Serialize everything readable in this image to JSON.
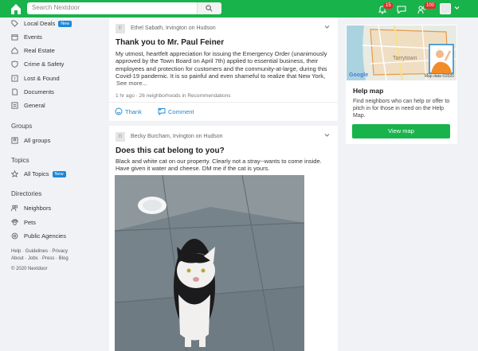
{
  "search": {
    "placeholder": "Search Nextdoor"
  },
  "top": {
    "notifications_count": "15",
    "inbox_count": "",
    "neighbors_count": "100"
  },
  "sidebar": {
    "items": [
      {
        "label": "Local Deals",
        "new": "New"
      },
      {
        "label": "Events"
      },
      {
        "label": "Real Estate"
      },
      {
        "label": "Crime & Safety"
      },
      {
        "label": "Lost & Found"
      },
      {
        "label": "Documents"
      },
      {
        "label": "General"
      }
    ],
    "groups_heading": "Groups",
    "groups": [
      {
        "label": "All groups"
      }
    ],
    "topics_heading": "Topics",
    "topics": [
      {
        "label": "All Topics",
        "new": "New"
      }
    ],
    "directories_heading": "Directories",
    "directories": [
      {
        "label": "Neighbors"
      },
      {
        "label": "Pets"
      },
      {
        "label": "Public Agencies"
      }
    ],
    "footer": {
      "line1": "Help · Guidelines · Privacy",
      "line2": "About · Jobs · Press · Blog",
      "copyright": "© 2020 Nextdoor"
    }
  },
  "posts": [
    {
      "avatar_letter": "E",
      "author": "Ethel Sabath, Irvington on Hudson",
      "title": "Thank you to Mr. Paul Feiner",
      "body_lines": [
        "My utmost, heartfelt appreciation for issuing the Emergency Order (unanimously",
        "approved by the Town Board on April 7th) applied to essential business, their",
        "employees and protection for customers and the community-at-large, during this",
        "Covid-19 pandemic. It is so painful and even shameful to realize that New York,"
      ],
      "see_more": "See more...",
      "meta": "1 hr ago · 26 neighborhoods in Recommendations",
      "thank_label": "Thank",
      "comment_label": "Comment"
    },
    {
      "avatar_letter": "B",
      "author": "Becky Burcham, Irvington on Hudson",
      "title": "Does this cat belong to you?",
      "body_lines": [
        "Black and white cat on our property.  Clearly not a stray--wants to come inside.",
        "Have given it water and cheese.  DM me if the cat is yours."
      ]
    }
  ],
  "help_map": {
    "map_label": "Tarrytown",
    "map_credit": "Map data ©2020",
    "google": "Google",
    "title": "Help map",
    "description": "Find neighbors who can help or offer to pitch in for those in need on the Help Map.",
    "button": "View map"
  }
}
